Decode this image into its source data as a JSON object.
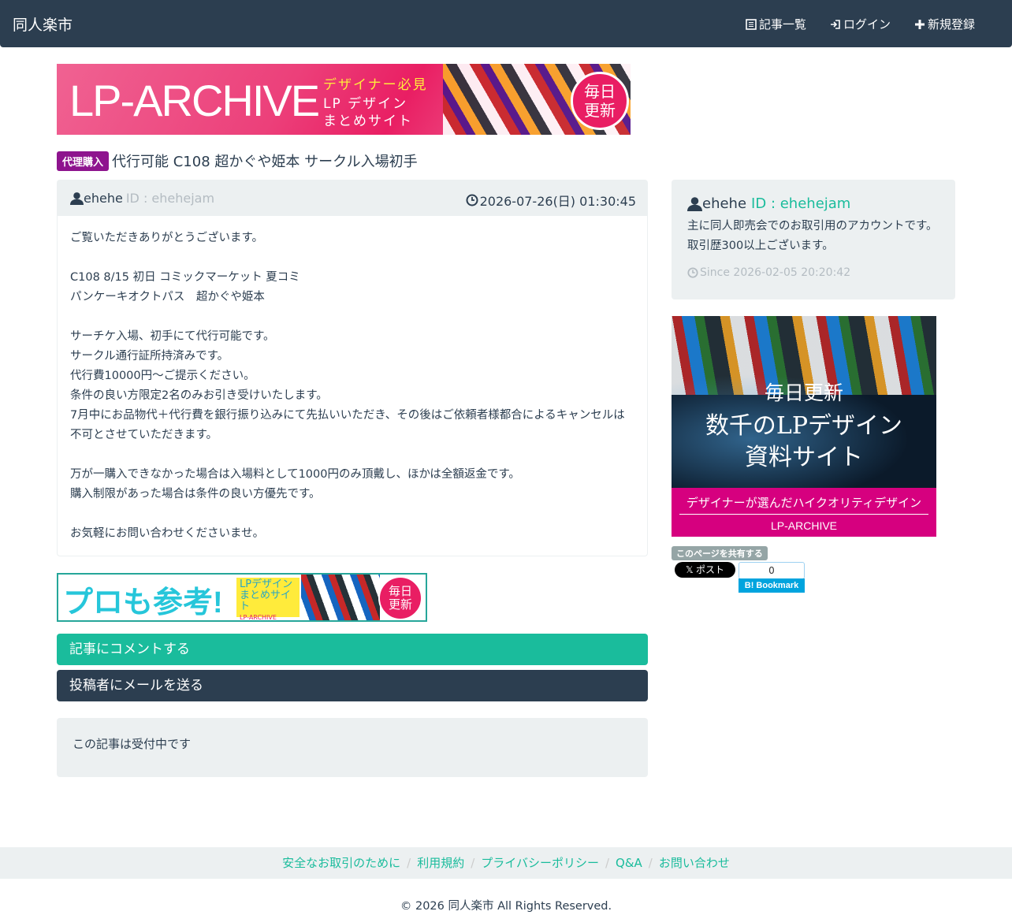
{
  "navbar": {
    "brand": "同人楽市",
    "links": [
      {
        "label": "記事一覧",
        "icon": "list-icon"
      },
      {
        "label": "ログイン",
        "icon": "login-icon"
      },
      {
        "label": "新規登録",
        "icon": "plus-icon"
      }
    ]
  },
  "banner_top": {
    "logo": "LP-ARCHIVE",
    "line1": "デザイナー必見",
    "line2": "LP デザイン",
    "line3": "まとめサイト",
    "badge1": "毎日",
    "badge2": "更新"
  },
  "post": {
    "category": "代理購入",
    "title": "代行可能 C108 超かぐや姫本 サークル入場初手",
    "author": "ehehe",
    "user_id": "ID : ehehejam",
    "posted_at": "2026-07-26(日) 01:30:45",
    "body": [
      "ご覧いただきありがとうございます。",
      "",
      "C108 8/15 初日 コミックマーケット 夏コミ",
      "パンケーキオクトパス　超かぐや姫本",
      "",
      "サーチケ入場、初手にて代行可能です。",
      "サークル通行証所持済みです。",
      "代行費10000円〜ご提示ください。",
      "条件の良い方限定2名のみお引き受けいたします。",
      "7月中にお品物代＋代行費を銀行振り込みにて先払いいただき、その後はご依頼者様都合によるキャンセルは不可とさせていただきます。",
      "",
      "万が一購入できなかった場合は入場料として1000円のみ頂戴し、ほかは全額返金です。",
      "購入制限があった場合は条件の良い方優先です。",
      "",
      "お気軽にお問い合わせくださいませ。"
    ]
  },
  "banner_mid": {
    "headline": "プロも参考!",
    "sub1": "LPデザイン",
    "sub2": "まとめサイト",
    "sub3": "LP-ARCHIVE",
    "badge1": "毎日",
    "badge2": "更新"
  },
  "actions": {
    "comment": "記事にコメントする",
    "mail": "投稿者にメールを送る"
  },
  "status": "この記事は受付中です",
  "sidebar": {
    "author": "ehehe",
    "user_id": "ID : ehehejam",
    "bio": "主に同人即売会でのお取引用のアカウントです。取引歴300以上ございます。",
    "since": "Since 2026-02-05 20:20:42",
    "banner": {
      "t1": "毎日更新",
      "t2a": "数千のLPデザイン",
      "t2b": "資料サイト",
      "foot1": "デザイナーが選んだハイクオリティデザイン",
      "foot2": "LP-ARCHIVE"
    },
    "share_label": "このページを共有する",
    "x_post": "𝕏 ポスト",
    "hatena_count": "0",
    "hatena_label": "B! Bookmark"
  },
  "footer": {
    "links": [
      "安全なお取引のために",
      "利用規約",
      "プライバシーポリシー",
      "Q&A",
      "お問い合わせ"
    ],
    "copyright": "© 2026 同人楽市 All Rights Reserved."
  },
  "colors": {
    "navbar": "#2c3e50",
    "accent": "#1abc9c",
    "category": "#8e148e",
    "well": "#ecf0f1"
  }
}
